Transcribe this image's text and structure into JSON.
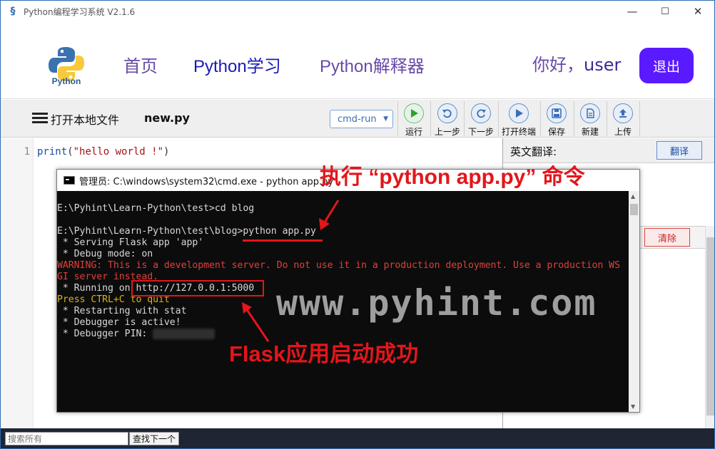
{
  "window": {
    "title": "Python编程学习系统 V2.1.6",
    "minimize": "—",
    "maximize": "☐",
    "close": "✕"
  },
  "nav": {
    "logo_text": "Python",
    "items": [
      {
        "label": "首页",
        "color": "#6a4aa8"
      },
      {
        "label": "Python学习",
        "color": "#1a1ab8"
      },
      {
        "label": "Python解释器",
        "color": "#6a4aa8"
      }
    ],
    "greeting_prefix": "你好，",
    "username": "user",
    "logout_label": "退出"
  },
  "toolbar": {
    "open_file_label": "打开本地文件",
    "file_name": "new.py",
    "run_mode": "cmd-run",
    "tools": [
      {
        "label": "运行",
        "icon": "play-icon"
      },
      {
        "label": "上一步",
        "icon": "undo-icon"
      },
      {
        "label": "下一步",
        "icon": "redo-icon"
      },
      {
        "label": "打开终端",
        "icon": "terminal-icon"
      },
      {
        "label": "保存",
        "icon": "save-icon"
      },
      {
        "label": "新建",
        "icon": "new-file-icon"
      },
      {
        "label": "上传",
        "icon": "upload-icon"
      }
    ]
  },
  "editor": {
    "line_number": "1",
    "code_fn": "print",
    "code_open": "(",
    "code_str": "\"hello world !\"",
    "code_close": ")"
  },
  "right_panel": {
    "title": "英文翻译:",
    "translate_label": "翻译",
    "clear_label": "清除"
  },
  "bottom": {
    "search_placeholder": "搜索所有",
    "find_next_label": "查找下一个"
  },
  "cmd": {
    "title": "管理员: C:\\windows\\system32\\cmd.exe - python  app.py",
    "lines": [
      {
        "text": "E:\\Pyhint\\Learn-Python\\test>cd blog",
        "color": "white"
      },
      {
        "text": "E:\\Pyhint\\Learn-Python\\test\\blog>python app.py",
        "color": "white"
      },
      {
        "text": " * Serving Flask app 'app'",
        "color": "white"
      },
      {
        "text": " * Debug mode: on",
        "color": "white"
      },
      {
        "text": "WARNING: This is a development server. Do not use it in a production deployment. Use a production WS",
        "color": "red"
      },
      {
        "text": "GI server instead.",
        "color": "red"
      },
      {
        "text": " * Running on http://127.0.0.1:5000",
        "color": "white"
      },
      {
        "text": "Press CTRL+C to quit",
        "color": "yellow"
      },
      {
        "text": " * Restarting with stat",
        "color": "white"
      },
      {
        "text": " * Debugger is active!",
        "color": "white"
      },
      {
        "text": " * Debugger PIN: ",
        "color": "white"
      }
    ],
    "pin_hidden": "700-795-566"
  },
  "annotations": {
    "command_note": "执行 “python app.py” 命令",
    "success_note": "Flask应用启动成功",
    "watermark": "www.pyhint.com"
  },
  "colors": {
    "accent": "#5a1aff",
    "annotation_red": "#e3161b"
  }
}
